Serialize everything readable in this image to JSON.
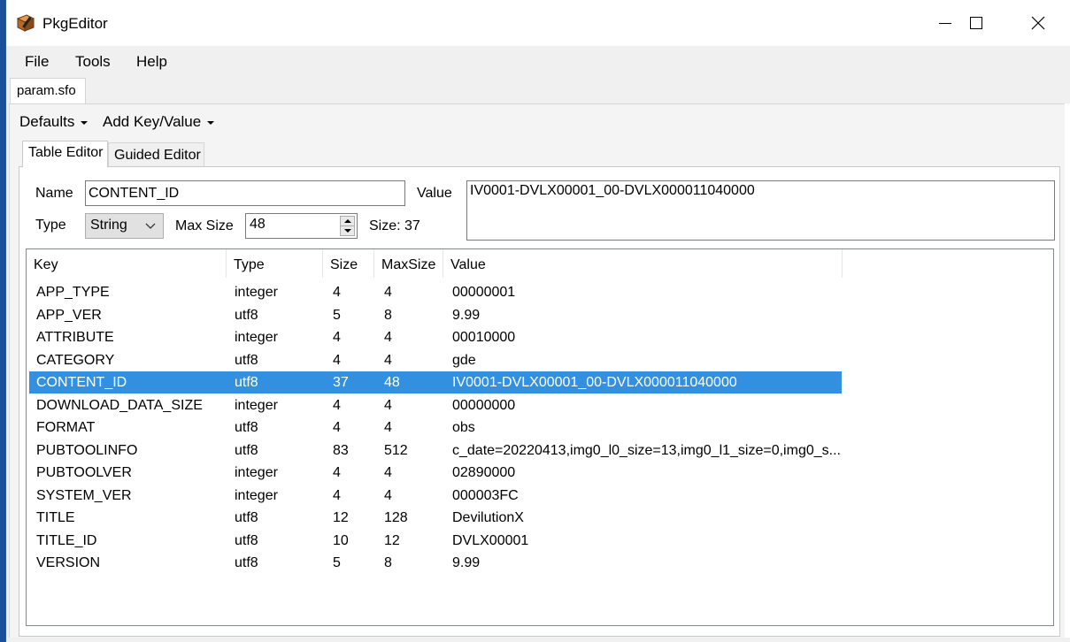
{
  "window": {
    "title": "PkgEditor"
  },
  "menu": [
    "File",
    "Tools",
    "Help"
  ],
  "document_tab": "param.sfo",
  "toolbar": {
    "defaults_label": "Defaults",
    "add_label": "Add Key/Value"
  },
  "editor_tabs": [
    "Table Editor",
    "Guided Editor"
  ],
  "form": {
    "name_label": "Name",
    "name_value": "CONTENT_ID",
    "value_label": "Value",
    "value_value": "IV0001-DVLX00001_00-DVLX000011040000",
    "type_label": "Type",
    "type_value": "String",
    "maxsize_label": "Max Size",
    "maxsize_value": "48",
    "size_text": "Size: 37"
  },
  "table": {
    "columns": [
      "Key",
      "Type",
      "Size",
      "MaxSize",
      "Value"
    ],
    "rows": [
      [
        "APP_TYPE",
        "integer",
        "4",
        "4",
        "00000001"
      ],
      [
        "APP_VER",
        "utf8",
        "5",
        "8",
        "9.99"
      ],
      [
        "ATTRIBUTE",
        "integer",
        "4",
        "4",
        "00010000"
      ],
      [
        "CATEGORY",
        "utf8",
        "4",
        "4",
        "gde"
      ],
      [
        "CONTENT_ID",
        "utf8",
        "37",
        "48",
        "IV0001-DVLX00001_00-DVLX000011040000"
      ],
      [
        "DOWNLOAD_DATA_SIZE",
        "integer",
        "4",
        "4",
        "00000000"
      ],
      [
        "FORMAT",
        "utf8",
        "4",
        "4",
        "obs"
      ],
      [
        "PUBTOOLINFO",
        "utf8",
        "83",
        "512",
        "c_date=20220413,img0_l0_size=13,img0_l1_size=0,img0_s..."
      ],
      [
        "PUBTOOLVER",
        "integer",
        "4",
        "4",
        "02890000"
      ],
      [
        "SYSTEM_VER",
        "integer",
        "4",
        "4",
        "000003FC"
      ],
      [
        "TITLE",
        "utf8",
        "12",
        "128",
        "DevilutionX"
      ],
      [
        "TITLE_ID",
        "utf8",
        "10",
        "12",
        "DVLX00001"
      ],
      [
        "VERSION",
        "utf8",
        "5",
        "8",
        "9.99"
      ]
    ],
    "selected_index": 4
  },
  "icons": [
    "pkgeditor-app-icon",
    "minimize-icon",
    "maximize-icon",
    "close-icon",
    "dropdown-arrow-icon",
    "chevron-down-icon",
    "spin-up-icon",
    "spin-down-icon"
  ],
  "colors": {
    "selection": "#3390e0",
    "desktop": "#1a4f9c",
    "titlebar": "#ffffff"
  }
}
